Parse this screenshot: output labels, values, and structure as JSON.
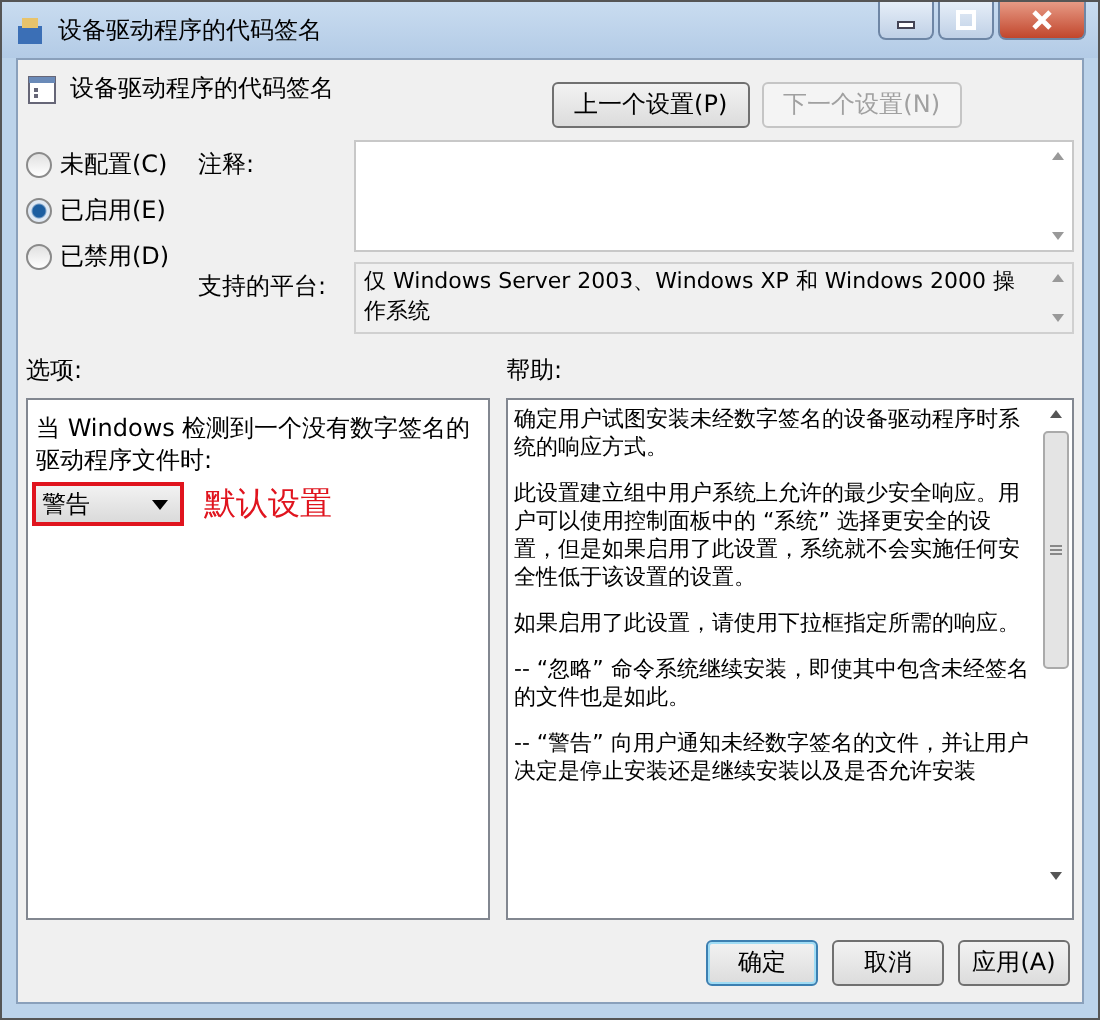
{
  "window": {
    "title": "设备驱动程序的代码签名"
  },
  "header": {
    "title": "设备驱动程序的代码签名",
    "buttons": [
      {
        "label": "上一个设置(P)",
        "disabled": false
      },
      {
        "label": "下一个设置(N)",
        "disabled": true
      }
    ]
  },
  "state_options": [
    {
      "label": "未配置(C)",
      "selected": false
    },
    {
      "label": "已启用(E)",
      "selected": true
    },
    {
      "label": "已禁用(D)",
      "selected": false
    }
  ],
  "comment": {
    "label": "注释:"
  },
  "platform": {
    "label": "支持的平台:",
    "value": "仅 Windows Server 2003、Windows XP 和 Windows 2000 操作系统"
  },
  "options": {
    "label": "选项:",
    "prompt": "当 Windows 检测到一个没有数字签名的驱动程序文件时:",
    "dropdown": {
      "value": "警告",
      "highlighted": true
    },
    "annotation": "默认设置"
  },
  "help": {
    "label": "帮助:",
    "paragraphs": [
      "确定用户试图安装未经数字签名的设备驱动程序时系统的响应方式。",
      "此设置建立组中用户系统上允许的最少安全响应。用户可以使用控制面板中的 “系统” 选择更安全的设置，但是如果启用了此设置，系统就不会实施任何安全性低于该设置的设置。",
      "如果启用了此设置，请使用下拉框指定所需的响应。",
      "-- “忽略” 命令系统继续安装，即使其中包含未经签名的文件也是如此。",
      "-- “警告” 向用户通知未经数字签名的文件，并让用户决定是停止安装还是继续安装以及是否允许安装"
    ]
  },
  "footer": {
    "buttons": [
      {
        "label": "确定",
        "default": true
      },
      {
        "label": "取消",
        "default": false
      },
      {
        "label": "应用(A)",
        "default": false
      }
    ]
  }
}
